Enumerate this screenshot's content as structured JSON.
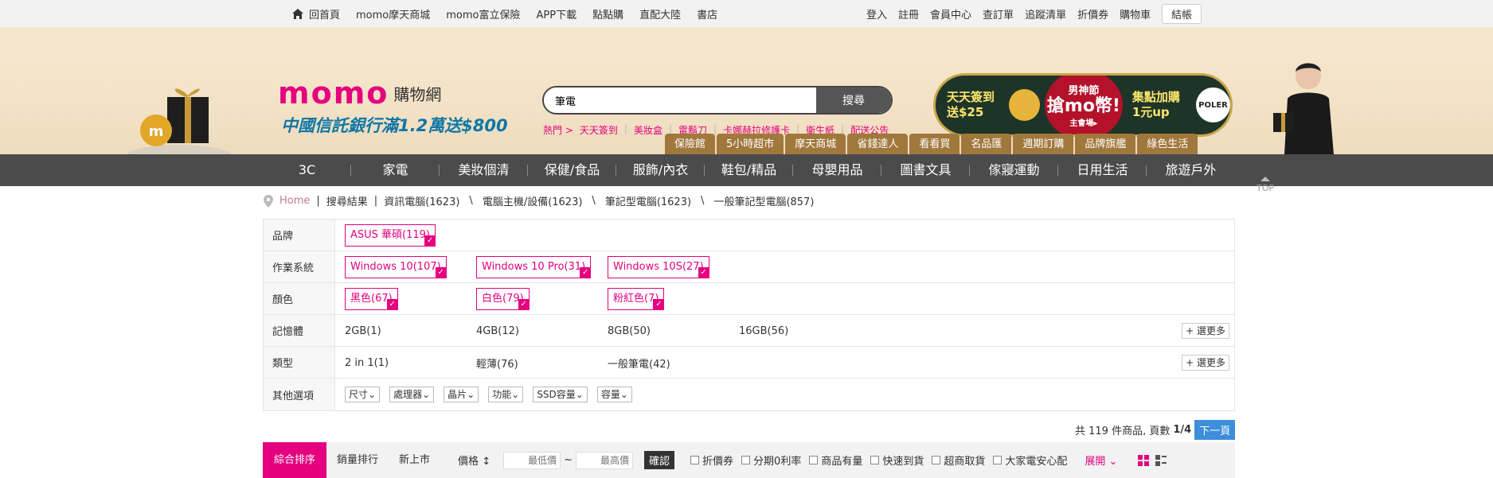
{
  "topbar": {
    "left": [
      "回首頁",
      "momo摩天商城",
      "momo富立保險",
      "APP下載",
      "點點購",
      "直配大陸",
      "書店"
    ],
    "right": [
      "登入",
      "註冊",
      "會員中心",
      "查訂單",
      "追蹤清單",
      "折價券",
      "購物車"
    ],
    "checkout": "結帳"
  },
  "header": {
    "logo_text": "momo",
    "logo_sub": "購物網",
    "promo": "中國信託銀行滿1.2萬送$800",
    "search_value": "筆電",
    "search_button": "搜尋",
    "hot_label": "熱門 >",
    "hot_links": [
      "天天簽到",
      "美妝盒",
      "電鬍刀",
      "卡娜赫拉修護卡",
      "衛生紙",
      "配送公告"
    ],
    "banner": {
      "left_text1": "天天簽到",
      "left_text2": "送$25",
      "seal_line1": "男神節",
      "seal_line2": "搶mo幣!",
      "seal_line3": "主會場▸",
      "right_text1": "集點加購",
      "right_text2": "1元up",
      "brand": "POLER"
    },
    "categories": [
      "保險館",
      "5小時超市",
      "摩天商城",
      "省錢達人",
      "看看買",
      "名品匯",
      "週期訂購",
      "品牌旗艦",
      "綠色生活"
    ]
  },
  "nav": [
    "3C",
    "家電",
    "美妝個清",
    "保健/食品",
    "服飾/內衣",
    "鞋包/精品",
    "母嬰用品",
    "圖書文具",
    "傢寢運動",
    "日用生活",
    "旅遊戶外"
  ],
  "top_label": "TOP",
  "breadcrumb": [
    "Home",
    "搜尋結果",
    "資訊電腦(1623)",
    "電腦主機/設備(1623)",
    "筆記型電腦(1623)",
    "一般筆記型電腦(857)"
  ],
  "filters": {
    "brand": {
      "label": "品牌",
      "opts": [
        "ASUS 華碩(119)"
      ]
    },
    "os": {
      "label": "作業系統",
      "opts": [
        "Windows 10(107)",
        "Windows 10 Pro(31)",
        "Windows 10S(27)"
      ]
    },
    "color": {
      "label": "顏色",
      "opts": [
        "黑色(67)",
        "白色(79)",
        "粉紅色(7)"
      ]
    },
    "memory": {
      "label": "記憶體",
      "opts": [
        "2GB(1)",
        "4GB(12)",
        "8GB(50)",
        "16GB(56)"
      ]
    },
    "type": {
      "label": "類型",
      "opts": [
        "2 in 1(1)",
        "輕薄(76)",
        "一般筆電(42)"
      ]
    },
    "other": {
      "label": "其他選項",
      "opts": [
        "尺寸",
        "處理器",
        "晶片",
        "功能",
        "SSD容量",
        "容量"
      ]
    },
    "more": "+ 選更多"
  },
  "paging": {
    "prefix": "共 119 件商品, 頁數",
    "page": "1/4",
    "next": "下一頁"
  },
  "sortbar": {
    "tabs": [
      "綜合排序",
      "銷量排行",
      "新上市"
    ],
    "price_label": "價格",
    "min_placeholder": "最低價",
    "max_placeholder": "最高價",
    "tilde": "~",
    "confirm": "確認",
    "checks": [
      "折價券",
      "分期0利率",
      "商品有量",
      "快速到貨",
      "超商取貨",
      "大家電安心配"
    ],
    "expand": "展開"
  },
  "colors": {
    "brand": "#e4007f",
    "gold": "#a1783c",
    "nav": "#4b4b4b",
    "promo": "#0f77a6"
  }
}
